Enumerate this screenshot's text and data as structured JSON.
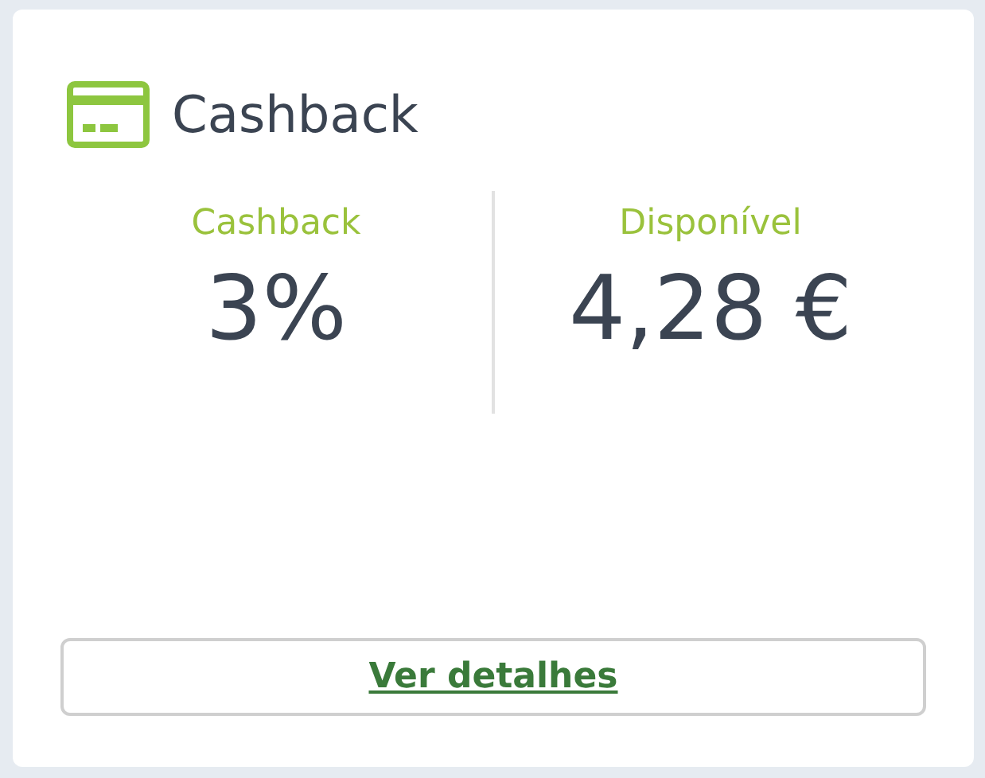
{
  "card": {
    "title": "Cashback",
    "stats": [
      {
        "label": "Cashback",
        "value": "3%"
      },
      {
        "label": "Disponível",
        "value": "4,28 €"
      }
    ],
    "button": "Ver detalhes"
  }
}
